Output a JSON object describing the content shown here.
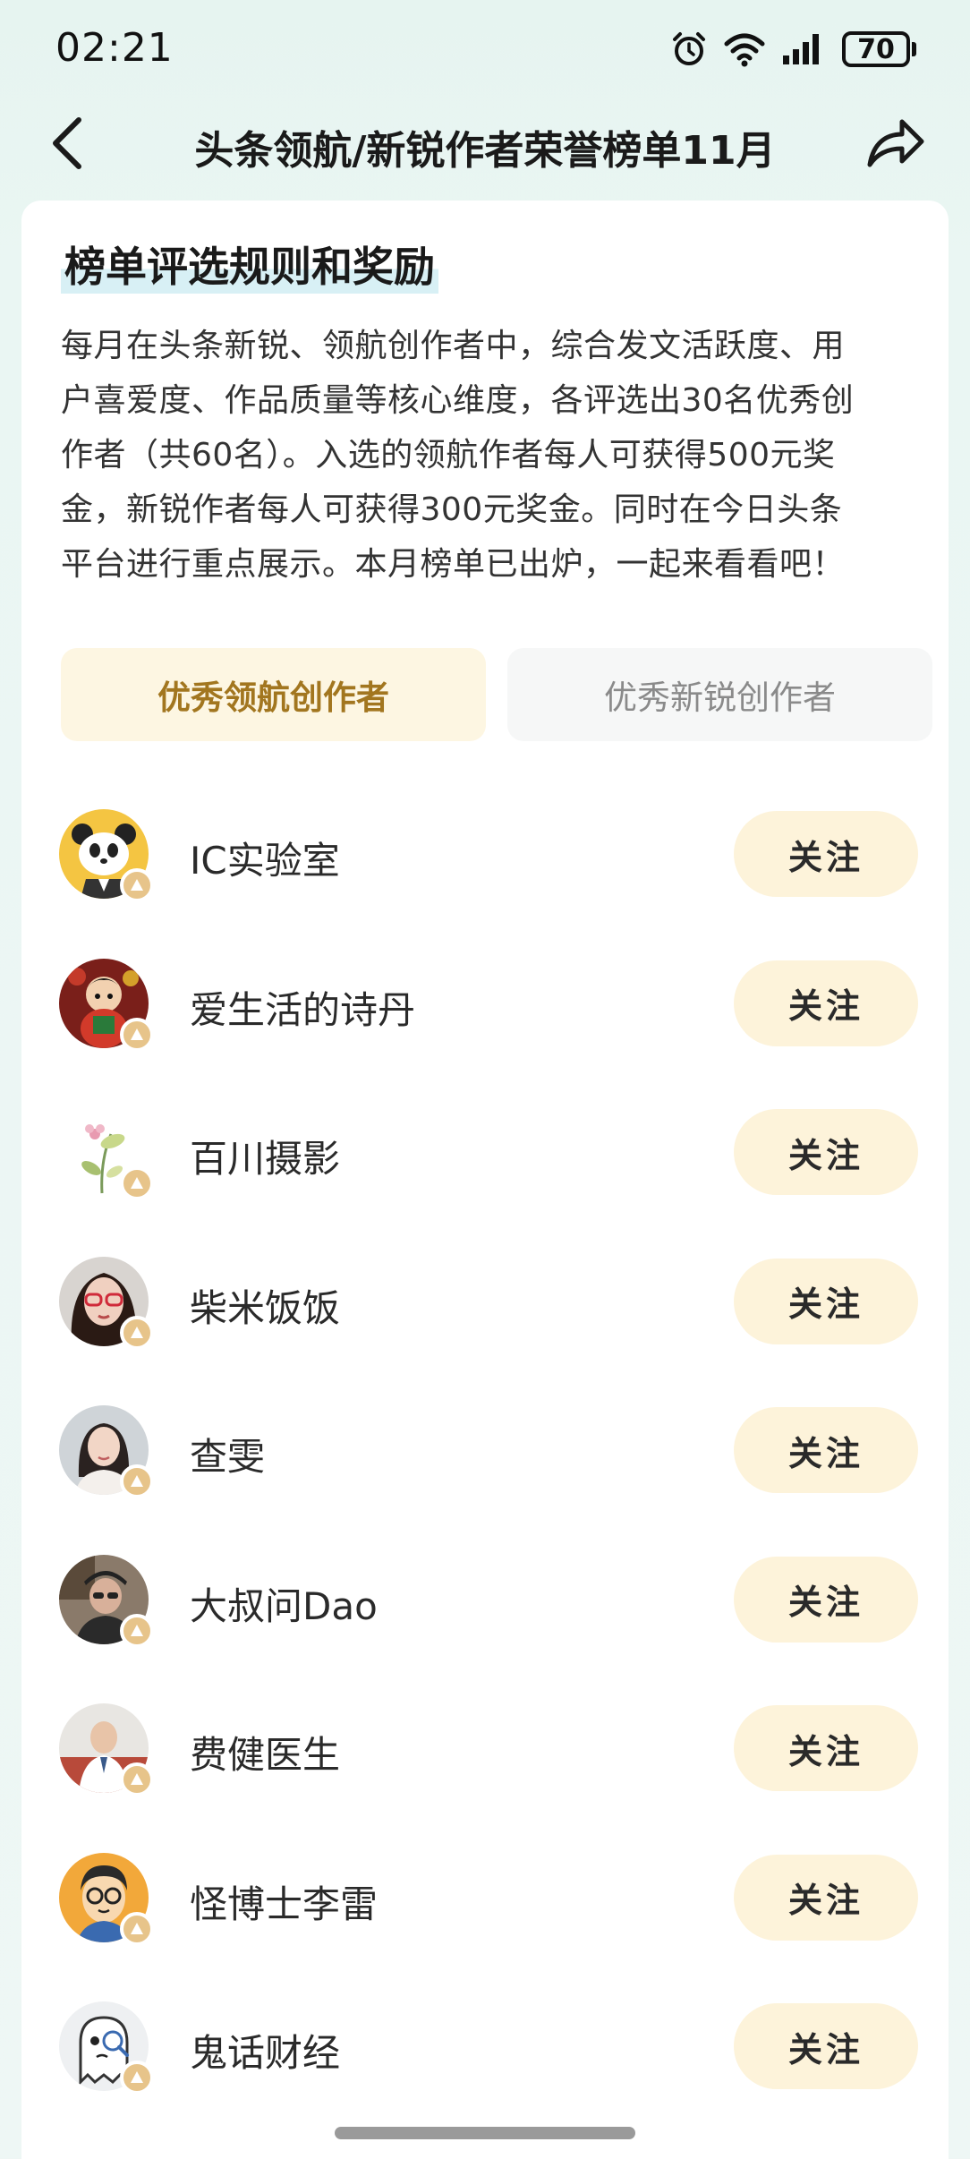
{
  "status_bar": {
    "time": "02:21",
    "battery": "70",
    "icons": [
      "alarm-icon",
      "wifi-icon",
      "signal-icon",
      "battery-icon"
    ]
  },
  "nav": {
    "title": "头条领航/新锐作者荣誉榜单11月",
    "back_icon": "chevron-left-icon",
    "share_icon": "share-arrow-icon"
  },
  "rules": {
    "title": "榜单评选规则和奖励",
    "lines": [
      "每月在头条新锐、领航创作者中，综合发文活跃度、用",
      "户喜爱度、作品质量等核心维度，各评选出30名优秀创",
      "作者（共60名）。入选的领航作者每人可获得500元奖",
      "金，新锐作者每人可获得300元奖金。同时在今日头条",
      "平台进行重点展示。本月榜单已出炉，一起来看看吧！"
    ]
  },
  "tabs": [
    {
      "label": "优秀领航创作者",
      "active": true
    },
    {
      "label": "优秀新锐创作者",
      "active": false
    }
  ],
  "follow_label": "关注",
  "authors": [
    {
      "name": "IC实验室",
      "avatar": "panda-avatar"
    },
    {
      "name": "爱生活的诗丹",
      "avatar": "doll-avatar"
    },
    {
      "name": "百川摄影",
      "avatar": "flower-avatar"
    },
    {
      "name": "柴米饭饭",
      "avatar": "woman-glasses-avatar"
    },
    {
      "name": "查雯",
      "avatar": "woman-avatar"
    },
    {
      "name": "大叔问Dao",
      "avatar": "man-cap-avatar"
    },
    {
      "name": "费健医生",
      "avatar": "doctor-avatar"
    },
    {
      "name": "怪博士李雷",
      "avatar": "cartoon-man-avatar"
    },
    {
      "name": "鬼话财经",
      "avatar": "ghost-avatar"
    }
  ],
  "colors": {
    "background": "#e6f4f0",
    "accent_gold": "#a2761f",
    "follow_bg": "#fdf3da",
    "active_tab_bg": "#fdf6e2"
  }
}
